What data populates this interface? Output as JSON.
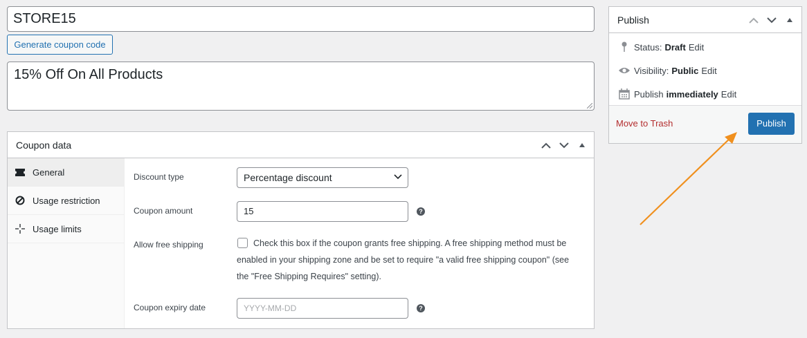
{
  "coupon": {
    "code": "STORE15",
    "generate_label": "Generate coupon code",
    "description": "15% Off On All Products"
  },
  "coupon_data": {
    "title": "Coupon data",
    "tabs": [
      {
        "label": "General",
        "icon": "ticket-icon"
      },
      {
        "label": "Usage restriction",
        "icon": "ban-icon"
      },
      {
        "label": "Usage limits",
        "icon": "crosshair-icon"
      }
    ],
    "general": {
      "discount_type_label": "Discount type",
      "discount_type_value": "Percentage discount",
      "amount_label": "Coupon amount",
      "amount_value": "15",
      "free_shipping_label": "Allow free shipping",
      "free_shipping_text": "Check this box if the coupon grants free shipping. A free shipping method must be enabled in your shipping zone and be set to require \"a valid free shipping coupon\" (see the \"Free Shipping Requires\" setting).",
      "expiry_label": "Coupon expiry date",
      "expiry_placeholder": "YYYY-MM-DD"
    }
  },
  "publish": {
    "title": "Publish",
    "status_label": "Status:",
    "status_value": "Draft",
    "visibility_label": "Visibility:",
    "visibility_value": "Public",
    "publish_label": "Publish",
    "publish_value": "immediately",
    "edit_label": "Edit",
    "trash_label": "Move to Trash",
    "button_label": "Publish"
  },
  "colors": {
    "accent": "#2271b1",
    "trash": "#b32d2e",
    "annotation_arrow": "#f0901e"
  }
}
